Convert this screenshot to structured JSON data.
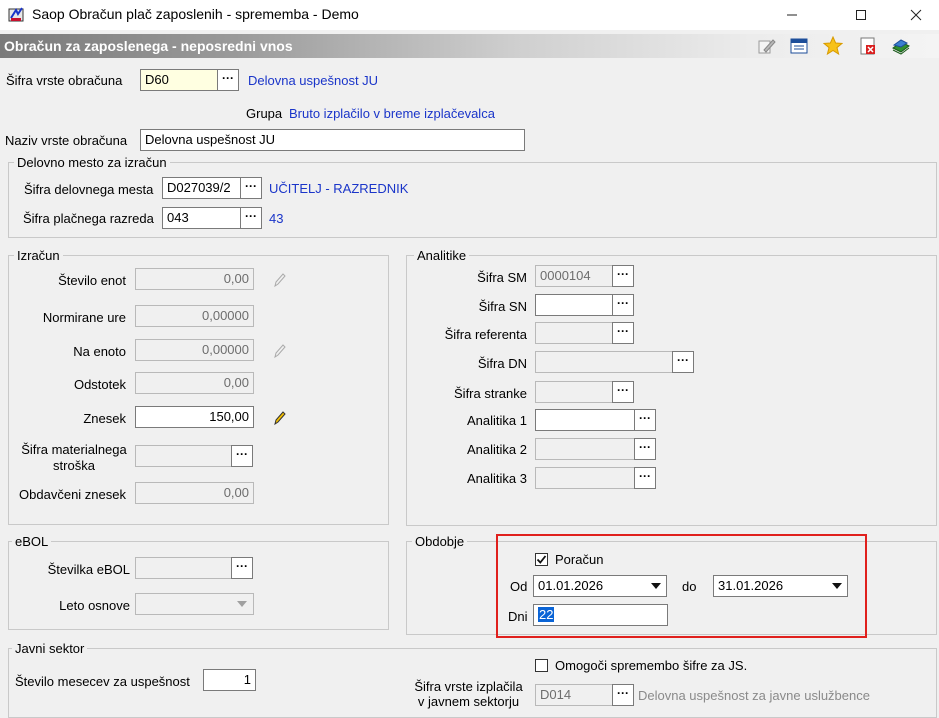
{
  "window": {
    "title": "Saop Obračun plač zaposlenih - sprememba - Demo",
    "minimize": "—",
    "maximize": "☐",
    "close": "✕"
  },
  "header": {
    "title": "Obračun za zaposlenega - neposredni vnos",
    "toolbar_icons": [
      "edit-icon",
      "list-icon",
      "star-icon",
      "delete-icon",
      "books-icon"
    ]
  },
  "top": {
    "sifra_label": "Šifra vrste obračuna",
    "sifra_value": "D60",
    "sifra_desc": "Delovna uspešnost JU",
    "grupa_label": "Grupa",
    "grupa_value": "Bruto izplačilo v breme izplačevalca",
    "naziv_label": "Naziv vrste obračuna",
    "naziv_value": "Delovna uspešnost JU"
  },
  "delovno": {
    "legend": "Delovno mesto za izračun",
    "dm_label": "Šifra delovnega mesta",
    "dm_value": "D027039/2",
    "dm_desc": "UČITELJ - RAZREDNIK",
    "pr_label": "Šifra plačnega razreda",
    "pr_value": "043",
    "pr_desc": "43"
  },
  "izracun": {
    "legend": "Izračun",
    "stevilo_label": "Število enot",
    "stevilo_value": "0,00",
    "normirane_label": "Normirane ure",
    "normirane_value": "0,00000",
    "naenoto_label": "Na enoto",
    "naenoto_value": "0,00000",
    "odstotek_label": "Odstotek",
    "odstotek_value": "0,00",
    "znesek_label": "Znesek",
    "znesek_value": "150,00",
    "material_label1": "Šifra materialnega",
    "material_label2": "stroška",
    "material_value": "",
    "obdavceni_label": "Obdavčeni znesek",
    "obdavceni_value": "0,00"
  },
  "analitike": {
    "legend": "Analitike",
    "sm_label": "Šifra SM",
    "sm_value": "0000104",
    "sn_label": "Šifra SN",
    "sn_value": "",
    "ref_label": "Šifra referenta",
    "ref_value": "",
    "dn_label": "Šifra DN",
    "dn_value": "",
    "stranke_label": "Šifra stranke",
    "stranke_value": "",
    "a1_label": "Analitika 1",
    "a1_value": "",
    "a2_label": "Analitika 2",
    "a2_value": "",
    "a3_label": "Analitika 3",
    "a3_value": ""
  },
  "ebol": {
    "legend": "eBOL",
    "stevilka_label": "Številka eBOL",
    "stevilka_value": "",
    "leto_label": "Leto osnove",
    "leto_value": ""
  },
  "obdobje": {
    "legend": "Obdobje",
    "poracun_label": "Poračun",
    "poracun_checked": true,
    "od_label": "Od",
    "od_value": "01.01.2026",
    "do_label": "do",
    "do_value": "31.01.2026",
    "dni_label": "Dni",
    "dni_value": "22"
  },
  "javni": {
    "legend": "Javni sektor",
    "mesecev_label": "Število mesecev za uspešnost",
    "mesecev_value": "1",
    "omogoci_label": "Omogoči spremembo šifre za JS.",
    "omogoci_checked": false,
    "izplacila_label1": "Šifra vrste izplačila",
    "izplacila_label2": "v javnem sektorju",
    "izplacila_value": "D014",
    "izplacila_desc": "Delovna uspešnost za javne uslužbence"
  },
  "colors": {
    "accent_blue": "#1a35c9",
    "highlight_red": "#e0201d",
    "selection": "#0a64d6"
  }
}
